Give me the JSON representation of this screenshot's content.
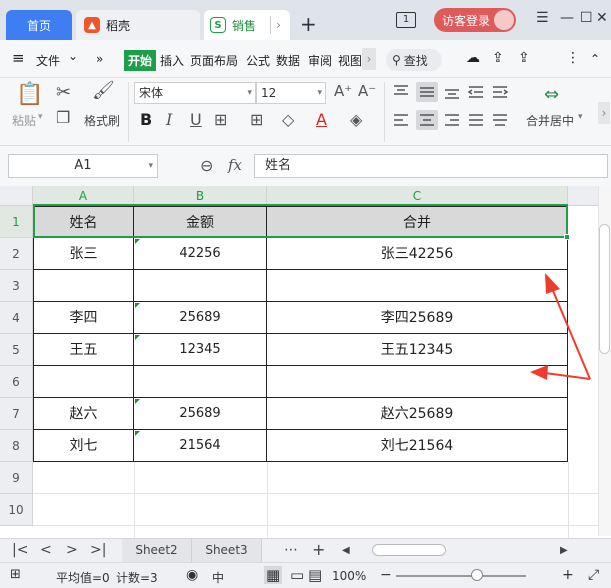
{
  "titlebar": {
    "tabs": [
      {
        "label": "首页"
      },
      {
        "label": "稻壳"
      },
      {
        "label": "销售"
      }
    ],
    "window_count": "1",
    "login_label": "访客登录",
    "icons": {
      "add": "plus-icon",
      "minimize": "minimize-icon",
      "restore": "restore-icon",
      "close": "close-icon",
      "menu": "hamburger-icon"
    },
    "controls": {
      "menu": "☰",
      "minimize": "—",
      "restore": "☐",
      "close": "✕",
      "add": "+",
      "next": "›"
    }
  },
  "menubar": {
    "file_label": "文件",
    "items": [
      "开始",
      "插入",
      "页面布局",
      "公式",
      "数据",
      "审阅",
      "视图"
    ],
    "search_label": "查找",
    "symbols": {
      "menu": "≡",
      "chevron_down": "⌄",
      "expand": "»",
      "more": "›",
      "search": "⚲",
      "cloud": "☁",
      "share": "⇪",
      "options": "⋮",
      "collapse": "⌃"
    }
  },
  "ribbon": {
    "paste_label": "粘贴",
    "format_painter_label": "格式刷",
    "font_name": "宋体",
    "font_size": "12",
    "merge_label": "合并居中",
    "symbols": {
      "paste": "📋",
      "cut": "✂",
      "copy": "❐",
      "brush": "🖌",
      "grow": "A⁺",
      "shrink": "A⁻",
      "bold": "B",
      "italic": "I",
      "underline": "U",
      "border": "⊞",
      "fill": "◇",
      "font_color": "A",
      "eraser": "◈",
      "merge": "⇔",
      "scroll_right": "›",
      "dropdown": "▾"
    }
  },
  "formulabar": {
    "cell_ref": "A1",
    "fx_label": "fx",
    "formula": "姓名",
    "symbols": {
      "zoom": "⊖",
      "dropdown": "▾"
    }
  },
  "grid": {
    "columns": [
      "A",
      "B",
      "C"
    ],
    "rows": [
      "1",
      "2",
      "3",
      "4",
      "5",
      "6",
      "7",
      "8",
      "9",
      "10"
    ],
    "cells": [
      [
        "姓名",
        "金额",
        "合并"
      ],
      [
        "张三",
        "42256",
        "张三42256"
      ],
      [
        "",
        "",
        ""
      ],
      [
        "李四",
        "25689",
        "李四25689"
      ],
      [
        "王五",
        "12345",
        "王五12345"
      ],
      [
        "",
        "",
        ""
      ],
      [
        "赵六",
        "25689",
        "赵六25689"
      ],
      [
        "刘七",
        "21564",
        "刘七21564"
      ]
    ]
  },
  "sheetbar": {
    "sheets": [
      "Sheet2",
      "Sheet3"
    ],
    "nav": {
      "first": "|<",
      "prev": "<",
      "next": ">",
      "last": ">|",
      "more": "⋯",
      "add": "+"
    }
  },
  "statusbar": {
    "average_label": "平均值=0",
    "count_label": "计数=3",
    "zoom_label": "100%",
    "symbols": {
      "eye": "◉",
      "mid": "中",
      "normal_view": "▦",
      "page_view": "▭",
      "break_view": "▤",
      "zoom_out": "−",
      "zoom_in": "+",
      "fullscreen": "⤢"
    }
  },
  "colors": {
    "accent": "#1e9e4a",
    "home_tab": "#3f7ef2",
    "login": "#e05a5a",
    "arrow": "#f03c2e"
  },
  "progress": {
    "zoom_slider_fraction": 0.58
  }
}
